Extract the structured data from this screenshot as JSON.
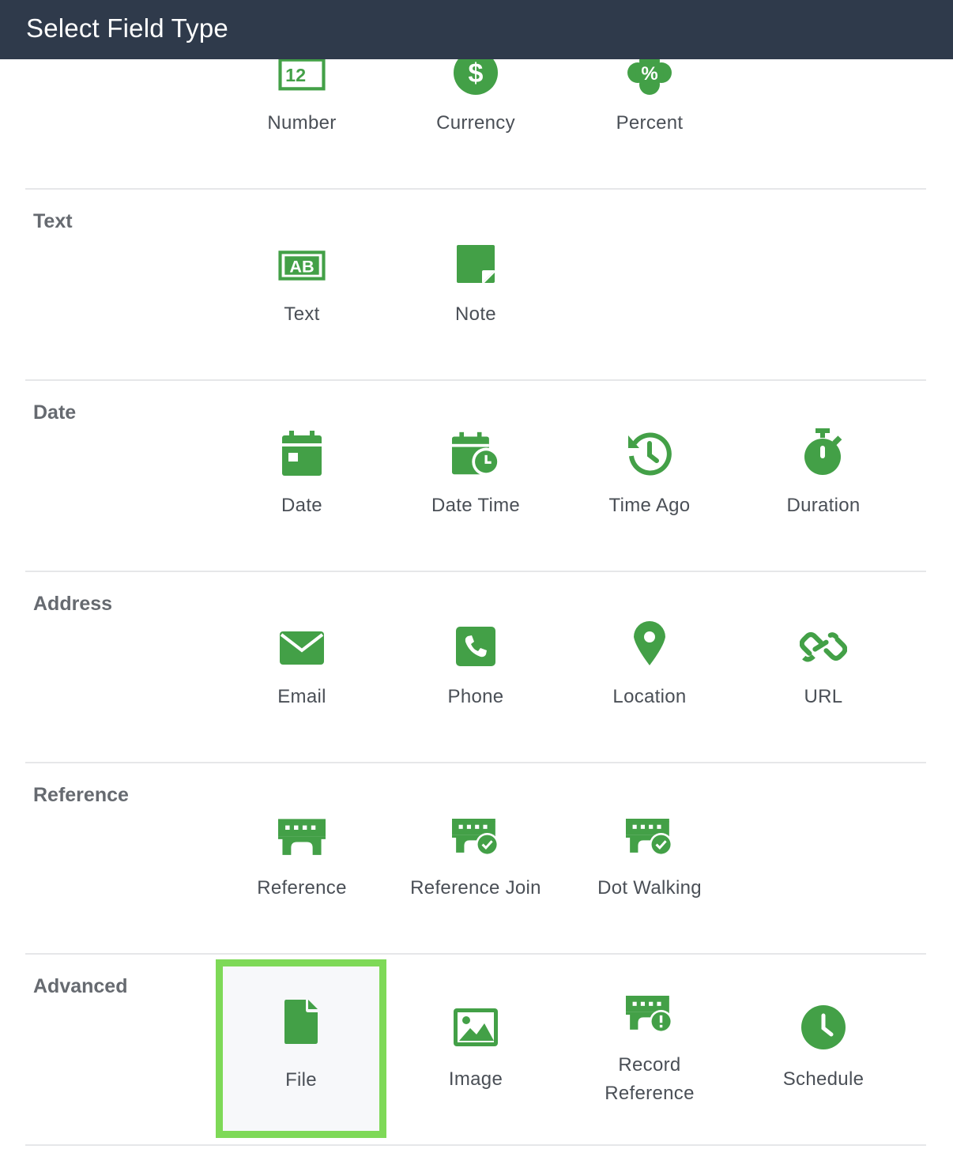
{
  "header": {
    "title": "Select Field Type"
  },
  "colors": {
    "header_bg": "#2f3a4b",
    "icon_green": "#43a047",
    "selected_border": "#7ed957",
    "section_title": "#666a70"
  },
  "sections": [
    {
      "title": "",
      "tiles": [
        {
          "label": "Number",
          "icon": "number-icon"
        },
        {
          "label": "Currency",
          "icon": "currency-icon"
        },
        {
          "label": "Percent",
          "icon": "percent-icon"
        }
      ]
    },
    {
      "title": "Text",
      "tiles": [
        {
          "label": "Text",
          "icon": "text-ab-icon"
        },
        {
          "label": "Note",
          "icon": "note-icon"
        }
      ]
    },
    {
      "title": "Date",
      "tiles": [
        {
          "label": "Date",
          "icon": "calendar-icon"
        },
        {
          "label": "Date Time",
          "icon": "calendar-clock-icon"
        },
        {
          "label": "Time Ago",
          "icon": "history-icon"
        },
        {
          "label": "Duration",
          "icon": "stopwatch-icon"
        }
      ]
    },
    {
      "title": "Address",
      "tiles": [
        {
          "label": "Email",
          "icon": "envelope-icon"
        },
        {
          "label": "Phone",
          "icon": "phone-icon"
        },
        {
          "label": "Location",
          "icon": "map-pin-icon"
        },
        {
          "label": "URL",
          "icon": "link-icon"
        }
      ]
    },
    {
      "title": "Reference",
      "tiles": [
        {
          "label": "Reference",
          "icon": "bridge-icon"
        },
        {
          "label": "Reference Join",
          "icon": "bridge-check-icon"
        },
        {
          "label": "Dot Walking",
          "icon": "bridge-check-icon"
        }
      ]
    },
    {
      "title": "Advanced",
      "tiles": [
        {
          "label": "File",
          "icon": "file-icon",
          "selected": true
        },
        {
          "label": "Image",
          "icon": "image-icon"
        },
        {
          "label": "Record\nReference",
          "icon": "bridge-alert-icon"
        },
        {
          "label": "Schedule",
          "icon": "clock-icon"
        }
      ]
    }
  ]
}
